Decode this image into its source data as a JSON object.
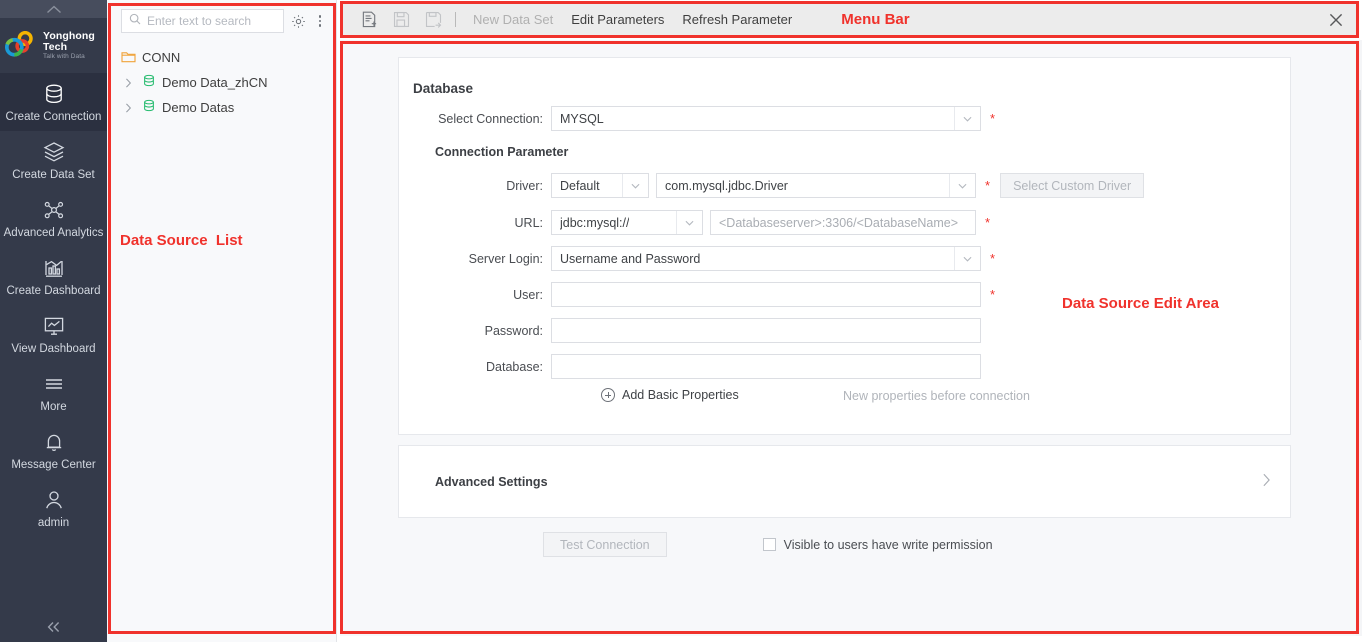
{
  "nav": {
    "collapse_top_icon": "chevron-up",
    "collapse_bottom_icon": "double-chevron-left",
    "logo_title": "Yonghong Tech",
    "logo_subtitle": "Talk with Data",
    "items": [
      {
        "label": "Create Connection",
        "icon": "database-icon",
        "active": true
      },
      {
        "label": "Create Data Set",
        "icon": "layers-icon",
        "active": false
      },
      {
        "label": "Advanced Analytics",
        "icon": "nodes-icon",
        "active": false
      },
      {
        "label": "Create Dashboard",
        "icon": "bar-chart-icon",
        "active": false
      },
      {
        "label": "View Dashboard",
        "icon": "monitor-chart-icon",
        "active": false
      },
      {
        "label": "More",
        "icon": "hamburger-icon",
        "active": false
      },
      {
        "label": "Message Center",
        "icon": "bell-icon",
        "active": false
      },
      {
        "label": "admin",
        "icon": "user-icon",
        "active": false
      }
    ]
  },
  "datasource_list": {
    "search_placeholder": "Enter text to search",
    "search_value": "",
    "settings_icon": "gear-icon",
    "more_icon": "kebab-menu-icon",
    "tree": [
      {
        "label": "CONN",
        "type": "folder",
        "expandable": false
      },
      {
        "label": "Demo Data_zhCN",
        "type": "connection",
        "expandable": true
      },
      {
        "label": "Demo Datas",
        "type": "connection",
        "expandable": true
      }
    ]
  },
  "menubar": {
    "icons": [
      {
        "name": "new-data-source-icon",
        "disabled": false
      },
      {
        "name": "save-icon",
        "disabled": true
      },
      {
        "name": "save-as-icon",
        "disabled": true
      }
    ],
    "items": [
      {
        "label": "New Data Set",
        "disabled": true
      },
      {
        "label": "Edit Parameters",
        "disabled": false
      },
      {
        "label": "Refresh Parameter",
        "disabled": false
      }
    ],
    "close_icon": "close-icon"
  },
  "annotations": {
    "menu_bar": "Menu Bar",
    "datasource_list": "Data Source  List",
    "edit_area": "Data Source Edit Area",
    "color": "#f0322c"
  },
  "form": {
    "section_title": "Database",
    "subsection_title": "Connection Parameter",
    "select_connection": {
      "label": "Select Connection:",
      "value": "MYSQL",
      "required": true
    },
    "driver": {
      "label": "Driver:",
      "mode_value": "Default",
      "class_value": "com.mysql.jdbc.Driver",
      "required": true,
      "custom_button": "Select Custom Driver",
      "custom_button_disabled": true
    },
    "url": {
      "label": "URL:",
      "scheme_value": "jdbc:mysql://",
      "host_placeholder": "<Databaseserver>:3306/<DatabaseName>",
      "host_value": "",
      "required": true
    },
    "server_login": {
      "label": "Server Login:",
      "value": "Username and Password",
      "required": true
    },
    "user": {
      "label": "User:",
      "value": "",
      "required": true
    },
    "password": {
      "label": "Password:",
      "value": "",
      "required": false
    },
    "database": {
      "label": "Database:",
      "value": "",
      "required": false
    },
    "add_basic_properties": "Add Basic Properties",
    "add_properties_hint": "New properties before connection",
    "advanced_settings": "Advanced Settings",
    "advanced_chevron": "chevron-right-icon",
    "test_connection": "Test Connection",
    "test_connection_disabled": true,
    "visible_permission": "Visible to users have write permission",
    "visible_permission_checked": false
  }
}
